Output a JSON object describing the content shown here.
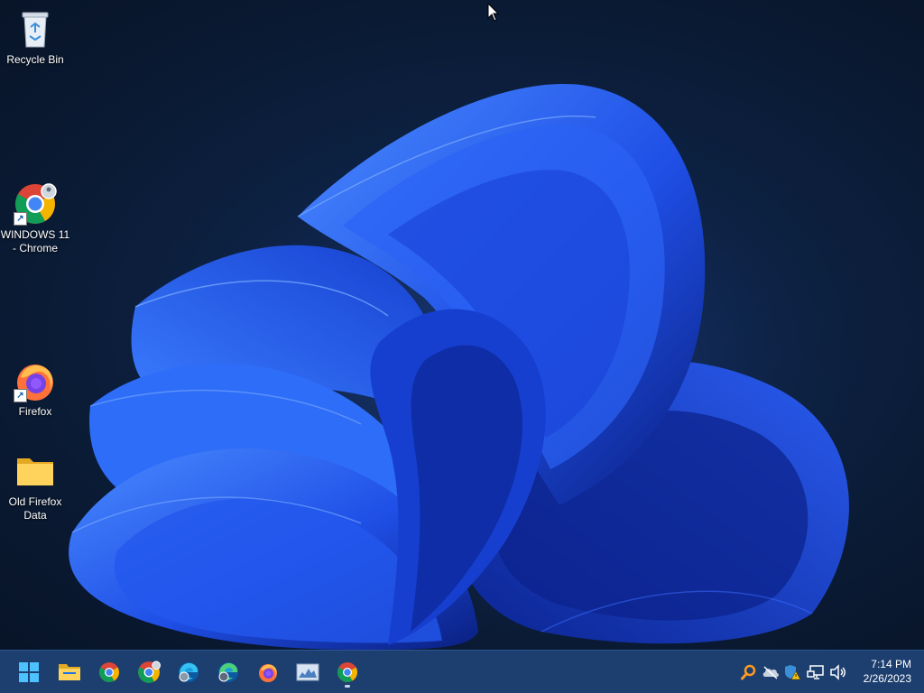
{
  "desktop": {
    "icons": [
      {
        "label": "Recycle Bin",
        "icon": "recycle-bin-icon"
      },
      {
        "label": "WINDOWS 11 - Chrome",
        "icon": "chrome-profile-icon"
      },
      {
        "label": "Firefox",
        "icon": "firefox-icon"
      },
      {
        "label": "Old Firefox Data",
        "icon": "folder-icon"
      }
    ]
  },
  "taskbar": {
    "apps": [
      {
        "name": "Start",
        "icon": "windows-start-icon"
      },
      {
        "name": "File Explorer",
        "icon": "file-explorer-icon"
      },
      {
        "name": "Google Chrome",
        "icon": "chrome-icon"
      },
      {
        "name": "Chrome profile",
        "icon": "chrome-profile-icon"
      },
      {
        "name": "Microsoft Edge",
        "icon": "edge-icon"
      },
      {
        "name": "Microsoft Edge profile",
        "icon": "edge-profile-icon"
      },
      {
        "name": "Firefox",
        "icon": "firefox-icon"
      },
      {
        "name": "Resource Monitor",
        "icon": "monitor-icon"
      },
      {
        "name": "Google Chrome (open)",
        "icon": "chrome-icon"
      }
    ],
    "tray": [
      {
        "name": "search",
        "icon": "magnifier-icon"
      },
      {
        "name": "onedrive",
        "icon": "onedrive-offline-icon"
      },
      {
        "name": "defender",
        "icon": "security-warning-icon"
      },
      {
        "name": "network",
        "icon": "network-icon"
      },
      {
        "name": "volume",
        "icon": "speaker-icon"
      }
    ],
    "clock": {
      "time": "7:14 PM",
      "date": "2/26/2023"
    }
  },
  "colors": {
    "taskbar": "#1d3f70",
    "bloom_light": "#3d7bff",
    "bloom_dark": "#0a2a9a",
    "background": "#0a1a33"
  }
}
